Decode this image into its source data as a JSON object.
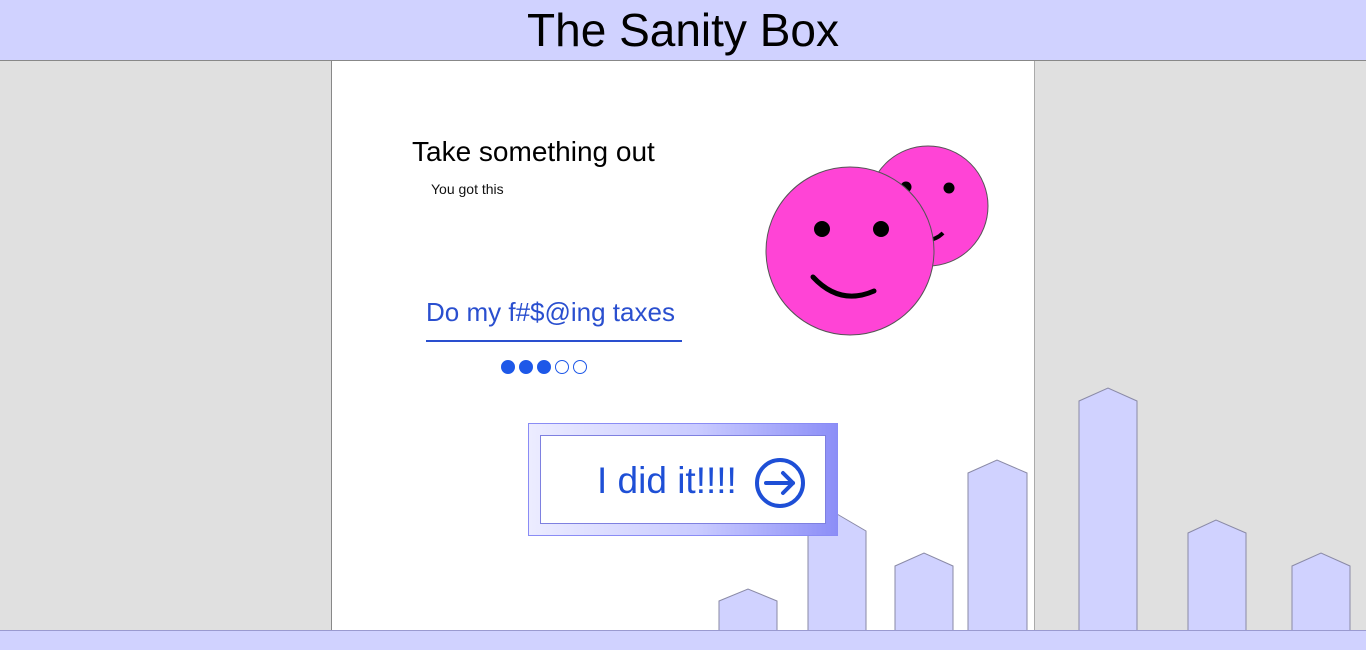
{
  "app": {
    "title": "The Sanity Box"
  },
  "task_card": {
    "heading": "Take something out",
    "subtitle": "You got this",
    "task_title": "Do my f#$@ing taxes",
    "progress": {
      "filled": 3,
      "total": 5
    },
    "done_button_label": "I did it!!!!"
  },
  "icons": {
    "done_button_icon": "arrow-right-circle-icon",
    "mascot": "smiley-faces-icon"
  },
  "colors": {
    "header_bg": "#d0d2ff",
    "accent_blue": "#1e4fd6",
    "smiley_pink": "#ff44d6",
    "skyline": "#d0d2ff"
  }
}
